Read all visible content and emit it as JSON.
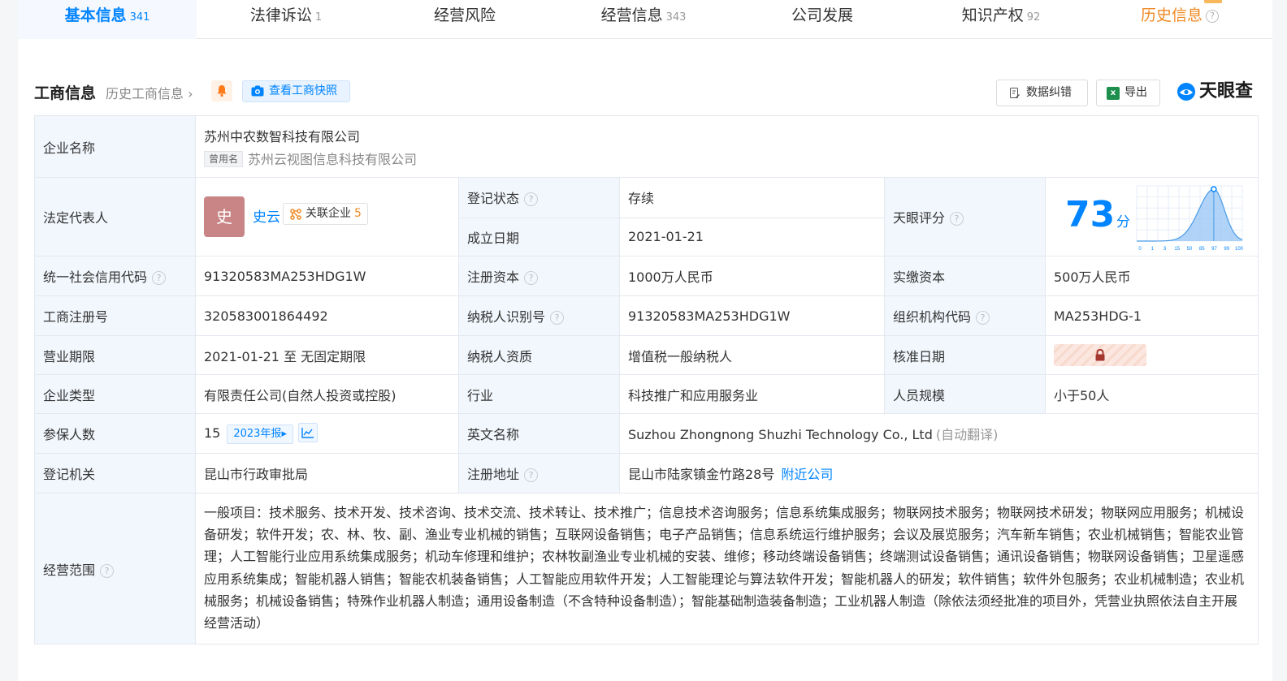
{
  "tabs": [
    {
      "label": "基本信息",
      "count": "341"
    },
    {
      "label": "法律诉讼",
      "count": "1"
    },
    {
      "label": "经营风险",
      "count": ""
    },
    {
      "label": "经营信息",
      "count": "343"
    },
    {
      "label": "公司发展",
      "count": ""
    },
    {
      "label": "知识产权",
      "count": "92"
    },
    {
      "label": "历史信息",
      "count": ""
    }
  ],
  "section": {
    "title": "工商信息",
    "history_link": "历史工商信息",
    "snapshot_label": "查看工商快照",
    "correction_label": "数据纠错",
    "export_label": "导出",
    "brand": "天眼查",
    "help_glyph": "?"
  },
  "company": {
    "name_label": "企业名称",
    "name": "苏州中农数智科技有限公司",
    "former_tag": "曾用名",
    "former_name": "苏州云视图信息科技有限公司",
    "rep_label": "法定代表人",
    "rep_avatar_char": "史",
    "rep_name": "史云",
    "rep_related_label": "关联企业",
    "rep_related_count": "5",
    "status_label": "登记状态",
    "status_value": "存续",
    "found_label": "成立日期",
    "found_value": "2021-01-21",
    "score_label": "天眼评分",
    "score_value": "73",
    "score_unit": "分",
    "credit_label": "统一社会信用代码",
    "credit_value": "91320583MA253HDG1W",
    "capital_label": "注册资本",
    "capital_value": "1000万人民币",
    "paid_label": "实缴资本",
    "paid_value": "500万人民币",
    "regno_label": "工商注册号",
    "regno_value": "320583001864492",
    "taxid_label": "纳税人识别号",
    "taxid_value": "91320583MA253HDG1W",
    "orgcode_label": "组织机构代码",
    "orgcode_value": "MA253HDG-1",
    "term_label": "营业期限",
    "term_value": "2021-01-21 至 无固定期限",
    "taxtype_label": "纳税人资质",
    "taxtype_value": "增值税一般纳税人",
    "approve_label": "核准日期",
    "type_label": "企业类型",
    "type_value": "有限责任公司(自然人投资或控股)",
    "industry_label": "行业",
    "industry_value": "科技推广和应用服务业",
    "staff_label": "人员规模",
    "staff_value": "小于50人",
    "insured_label": "参保人数",
    "insured_value": "15",
    "insured_year": "2023年报",
    "en_label": "英文名称",
    "en_value": "Suzhou Zhongnong Shuzhi Technology Co., Ltd",
    "en_note": "(自动翻译)",
    "authority_label": "登记机关",
    "authority_value": "昆山市行政审批局",
    "address_label": "注册地址",
    "address_value": "昆山市陆家镇金竹路28号",
    "nearby_label": "附近公司",
    "scope_label": "经营范围",
    "scope_value": "一般项目：技术服务、技术开发、技术咨询、技术交流、技术转让、技术推广；信息技术咨询服务；信息系统集成服务；物联网技术服务；物联网技术研发；物联网应用服务；机械设备研发；软件开发；农、林、牧、副、渔业专业机械的销售；互联网设备销售；电子产品销售；信息系统运行维护服务；会议及展览服务；汽车新车销售；农业机械销售；智能农业管理；人工智能行业应用系统集成服务；机动车修理和维护；农林牧副渔业专业机械的安装、维修；移动终端设备销售；终端测试设备销售；通讯设备销售；物联网设备销售；卫星遥感应用系统集成；智能机器人销售；智能农机装备销售；人工智能应用软件开发；人工智能理论与算法软件开发；智能机器人的研发；软件销售；软件外包服务；农业机械制造；农业机械服务；机械设备销售；特殊作业机器人制造；通用设备制造（不含特种设备制造）；智能基础制造装备制造；工业机器人制造（除依法须经批准的项目外，凭营业执照依法自主开展经营活动）"
  },
  "score_chart": {
    "ticks": [
      "0",
      "1",
      "3",
      "15",
      "50",
      "85",
      "97",
      "99",
      "100"
    ],
    "marker_value": 73
  },
  "colors": {
    "accent": "#0084ff",
    "history_tab": "#f08a24",
    "status_ok": "#32b34d",
    "label_bg": "#f2f7fd"
  }
}
